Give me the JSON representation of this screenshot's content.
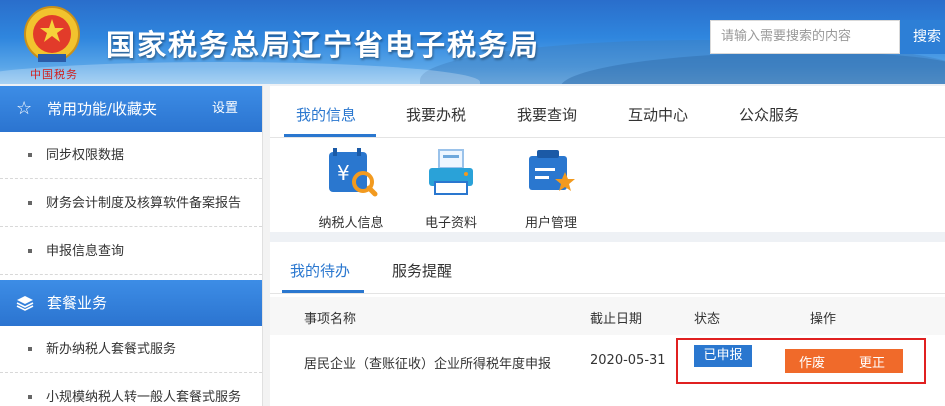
{
  "header": {
    "emblem_text": "中国税务",
    "title": "国家税务总局辽宁省电子税务局",
    "search_placeholder": "请输入需要搜索的内容",
    "search_button": "搜索"
  },
  "sidebar": {
    "section1": {
      "icon": "star-icon",
      "label": "常用功能/收藏夹",
      "settings": "设置"
    },
    "section1_items": [
      "同步权限数据",
      "财务会计制度及核算软件备案报告",
      "申报信息查询"
    ],
    "section2": {
      "icon": "layers-icon",
      "label": "套餐业务"
    },
    "section2_items": [
      "新办纳税人套餐式服务",
      "小规模纳税人转一般人套餐式服务"
    ]
  },
  "main_tabs": [
    "我的信息",
    "我要办税",
    "我要查询",
    "互动中心",
    "公众服务"
  ],
  "quick_links": [
    {
      "label": "纳税人信息",
      "icon": "taxpayer-info-icon"
    },
    {
      "label": "电子资料",
      "icon": "printer-icon"
    },
    {
      "label": "用户管理",
      "icon": "user-management-icon"
    }
  ],
  "todo_tabs": [
    "我的待办",
    "服务提醒"
  ],
  "table": {
    "headers": [
      "事项名称",
      "截止日期",
      "状态",
      "操作"
    ],
    "rows": [
      {
        "name": "居民企业（查账征收）企业所得税年度申报",
        "deadline": "2020-05-31",
        "status": "已申报",
        "op1": "作废",
        "op2": "更正"
      }
    ]
  },
  "colors": {
    "accent": "#2a77cf",
    "action": "#f06a2a",
    "highlight": "#e02020"
  }
}
